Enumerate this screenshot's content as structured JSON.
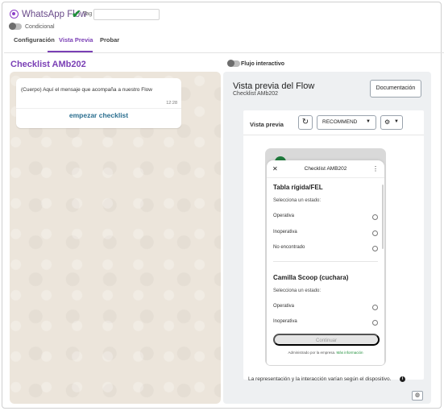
{
  "header": {
    "app_title": "WhatsApp Flow",
    "tag_label": "Tag",
    "tag_value": "",
    "conditional_label": "Condicional"
  },
  "tabs": [
    {
      "label": "Configuración"
    },
    {
      "label": "Vista Previa"
    },
    {
      "label": "Probar"
    }
  ],
  "active_tab": "Vista Previa",
  "section_title": "Checklist AMb202",
  "chat": {
    "message": "(Cuerpo) Aquí el mensaje que acompaña a nuestro Flow",
    "time": "12:28",
    "action_label": "empezar checklist"
  },
  "flow_toggle_label": "Flujo interactivo",
  "preview": {
    "title": "Vista previa del Flow",
    "subtitle": "Checklist AMb202",
    "doc_button": "Documentación",
    "card_label": "Vista previa",
    "mode_select": "RECOMMEND",
    "footnote": "La representación y la interacción varían según el dispositivo.",
    "colors": {
      "accent": "#7a3fb5",
      "check": "#1f8f3a",
      "link": "#2a6e8f"
    }
  },
  "sheet": {
    "title": "Checklist AMB202",
    "questions": [
      {
        "title": "Tabla rígida/FEL",
        "prompt": "Selecciona un estado:",
        "options": [
          "Operativa",
          "Inoperativa",
          "No encontrado"
        ]
      },
      {
        "title": "Camilla Scoop (cuchara)",
        "prompt": "Selecciona un estado:",
        "options": [
          "Operativa",
          "Inoperativa"
        ]
      }
    ],
    "continue_label": "Continuar",
    "managed_text": "Administrado por la empresa.",
    "managed_link": "Más información"
  }
}
